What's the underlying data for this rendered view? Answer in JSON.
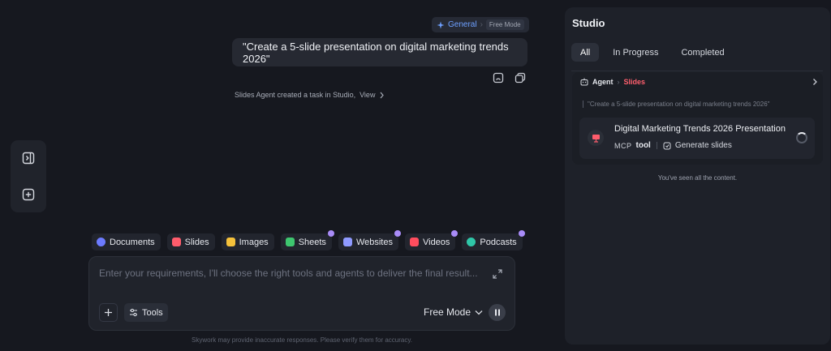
{
  "chat": {
    "mode_chip": {
      "general": "General",
      "free": "Free Mode"
    },
    "user_message": "\"Create a 5-slide presentation on digital marketing trends 2026\"",
    "agent_note": "Slides Agent created a task in Studio,",
    "agent_note_link": "View",
    "chips": [
      {
        "label": "Documents",
        "color": "#6c7bff",
        "badge": false
      },
      {
        "label": "Slides",
        "color": "#ff5c6c",
        "badge": false
      },
      {
        "label": "Images",
        "color": "#f5c13b",
        "badge": false
      },
      {
        "label": "Sheets",
        "color": "#3ec66f",
        "badge": true
      },
      {
        "label": "Websites",
        "color": "#8f9aff",
        "badge": true
      },
      {
        "label": "Videos",
        "color": "#ff4d5e",
        "badge": true
      },
      {
        "label": "Podcasts",
        "color": "#2fc6a8",
        "badge": true
      }
    ],
    "input": {
      "placeholder": "Enter your requirements, I'll choose the right tools and agents to deliver the final result...",
      "tools_label": "Tools",
      "mode_label": "Free Mode"
    },
    "disclaimer": "Skywork may provide inaccurate responses. Please verify them for accuracy."
  },
  "studio": {
    "title": "Studio",
    "tabs": [
      {
        "label": "All",
        "active": true
      },
      {
        "label": "In Progress",
        "active": false
      },
      {
        "label": "Completed",
        "active": false
      }
    ],
    "task": {
      "agent": "Agent",
      "type": "Slides",
      "quote": "\"Create a 5-slide presentation on digital marketing trends 2026\"",
      "item_name": "Digital Marketing Trends 2026 Presentation",
      "mcp": "MCP",
      "tool": "tool",
      "generate": "Generate slides"
    },
    "seen_text": "You've seen all the content."
  },
  "colors": {
    "background": "#16181f",
    "panel": "#1e2129",
    "accent_blue": "#6ea0ff",
    "accent_red": "#ff5f6d"
  }
}
